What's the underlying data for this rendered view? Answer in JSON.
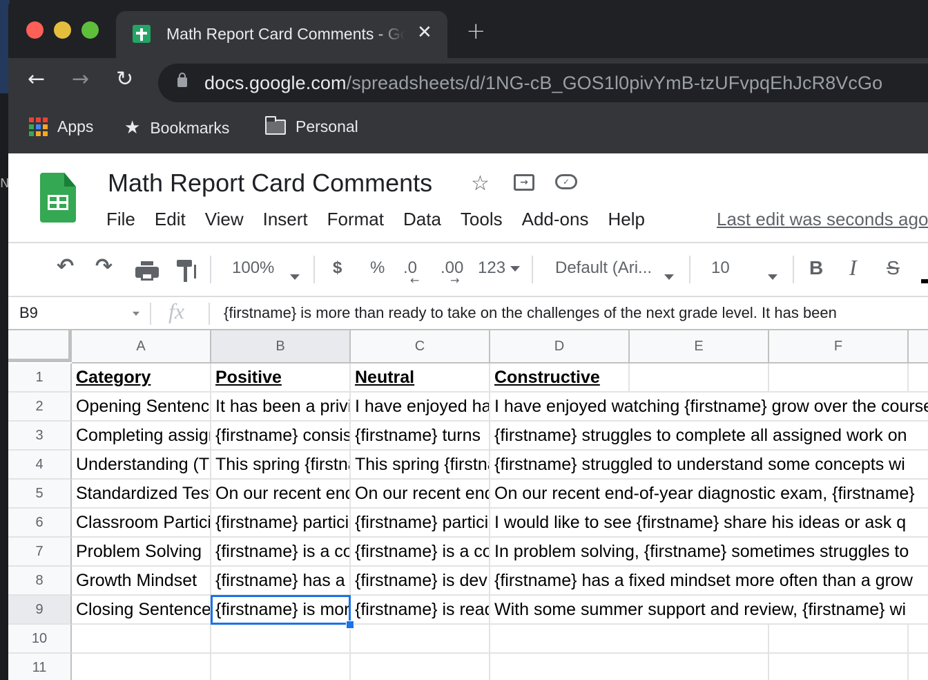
{
  "browser": {
    "tab": {
      "title": "Math Report Card Comments - Google Sheets",
      "close_icon": "close-icon"
    },
    "new_tab_icon": "plus-icon",
    "url": {
      "host": "docs.google.com",
      "path": "/spreadsheets/d/1NG-cB_GOS1l0pivYmB-tzUFvpqEhJcR8VcGo"
    },
    "bookmarks": [
      {
        "label": "Apps",
        "icon": "apps-grid-icon"
      },
      {
        "label": "Bookmarks",
        "icon": "star-icon"
      },
      {
        "label": "Personal",
        "icon": "folder-icon"
      }
    ]
  },
  "doc": {
    "title": "Math Report Card Comments",
    "menus": [
      "File",
      "Edit",
      "View",
      "Insert",
      "Format",
      "Data",
      "Tools",
      "Add-ons",
      "Help"
    ],
    "last_edit": "Last edit was seconds ago"
  },
  "toolbar": {
    "zoom": "100%",
    "currency": "$",
    "percent": "%",
    "decrease_decimal": ".0",
    "increase_decimal": ".00",
    "more_formats": "123",
    "font": "Default (Ari...",
    "font_size": "10",
    "bold": "B",
    "italic": "I",
    "strikethrough": "S"
  },
  "formula_bar": {
    "cell_ref": "B9",
    "fx": "fx",
    "content": "{firstname} is more than ready to take on the challenges of the next grade level.  It has been"
  },
  "sheet": {
    "columns": [
      "A",
      "B",
      "C",
      "D",
      "E",
      "F"
    ],
    "selected_column": "B",
    "selected_row": 9,
    "rows": [
      {
        "num": "1",
        "cells": [
          "Category",
          "Positive ",
          "Neutral",
          "Constructive",
          "",
          ""
        ]
      },
      {
        "num": "2",
        "cells": [
          "Opening Sentence",
          "It has been a privilege",
          "I have enjoyed having",
          "I have enjoyed watching {firstname} grow over the course",
          "",
          ""
        ]
      },
      {
        "num": "3",
        "cells": [
          "Completing assignments",
          "{firstname} consistently",
          "{firstname} turns",
          "{firstname} struggles to complete all assigned work on",
          "",
          ""
        ]
      },
      {
        "num": "4",
        "cells": [
          "Understanding (T",
          "This spring {firstname}",
          "This spring {firstname}",
          "{firstname} struggled to understand some concepts wi",
          "",
          ""
        ]
      },
      {
        "num": "5",
        "cells": [
          "Standardized Tests",
          "On our recent end",
          "On our recent end",
          "On our recent end-of-year diagnostic exam, {firstname}",
          "",
          ""
        ]
      },
      {
        "num": "6",
        "cells": [
          "Classroom Participation",
          "{firstname} participates",
          "{firstname} participates",
          "I would like to see {firstname} share his ideas or ask q",
          "",
          ""
        ]
      },
      {
        "num": "7",
        "cells": [
          "Problem Solving",
          "{firstname} is a con",
          "{firstname} is a con",
          "In problem solving, {firstname} sometimes struggles to",
          "",
          ""
        ]
      },
      {
        "num": "8",
        "cells": [
          "Growth Mindset ",
          "{firstname} has a",
          "{firstname} is dev",
          "{firstname} has a fixed mindset more often than a grow",
          "",
          ""
        ]
      },
      {
        "num": "9",
        "cells": [
          "Closing Sentence",
          "{firstname} is more",
          "{firstname} is ready",
          "With some summer support and review, {firstname} wi",
          "",
          ""
        ]
      },
      {
        "num": "10",
        "cells": [
          "",
          "",
          "",
          "",
          "",
          ""
        ]
      },
      {
        "num": "11",
        "cells": [
          "",
          "",
          "",
          "",
          "",
          ""
        ]
      }
    ]
  },
  "colors": {
    "accent": "#1a73e8",
    "sheets_green": "#34a853",
    "chrome_dark": "#202124"
  }
}
